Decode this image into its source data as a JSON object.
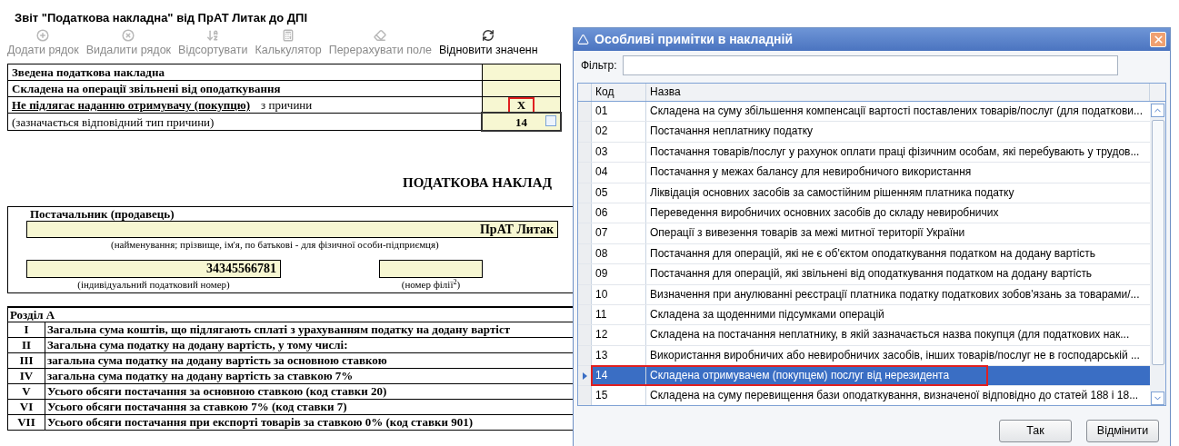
{
  "report": {
    "title": "Звіт \"Податкова накладна\" від ПрАТ Литак до ДПІ",
    "toolbar": [
      {
        "label": "Додати рядок",
        "disabled": true
      },
      {
        "label": "Видалити рядок",
        "disabled": true
      },
      {
        "label": "Відсортувати",
        "disabled": true
      },
      {
        "label": "Калькулятор",
        "disabled": true
      },
      {
        "label": "Перерахувати поле",
        "disabled": true
      },
      {
        "label": "Відновити значенн",
        "disabled": false
      }
    ],
    "flags": [
      {
        "kind": "flag",
        "label": "Зведена податкова накладна"
      },
      {
        "kind": "flag",
        "label": "Складена на операції звільнені від оподаткування"
      },
      {
        "kind": "reason",
        "label": "Не підлягає наданню отримувачу (покупцю)",
        "suffix": "з причини",
        "value": "X"
      },
      {
        "kind": "code",
        "label": "(зазначається відповідний тип причини)",
        "value": "14"
      }
    ],
    "heading": "ПОДАТКОВА НАКЛАД",
    "supplier": {
      "title": "Постачальник (продавець)",
      "name": "ПрАТ Литак",
      "name_caption": "(найменування; прізвище, ім'я, по батькові - для фізичної особи-підприємця)",
      "tax_number": "34345566781",
      "tax_number_caption": "(індивідуальний податковий номер)",
      "branch_caption": "(номер філії$^{2}$)"
    },
    "section": {
      "title": "Розділ А",
      "rows": [
        {
          "num": "I",
          "text": "Загальна сума коштів, що підлягають сплаті з урахуванням податку на додану вартіст"
        },
        {
          "num": "II",
          "text": "Загальна сума податку на додану вартість, у тому числі:"
        },
        {
          "num": "III",
          "text": "загальна сума податку на додану вартість за основною ставкою"
        },
        {
          "num": "IV",
          "text": "загальна сума податку на додану вартість за  ставкою 7%"
        },
        {
          "num": "V",
          "text": "Усього обсяги постачання за основною ставкою (код ставки 20)"
        },
        {
          "num": "VI",
          "text": "Усього обсяги постачання за ставкою 7% (код ставки 7)"
        },
        {
          "num": "VII",
          "text": "Усього обсяги постачання при експорті товарів за ставкою 0% (код ставки 901)"
        }
      ]
    }
  },
  "dialog": {
    "title": "Особливі примітки в накладній",
    "filter_label": "Фільтр:",
    "columns": [
      "Код",
      "Назва"
    ],
    "rows": [
      {
        "code": "01",
        "name": "Складена на суму збільшення компенсації вартості поставлених товарів/послуг (для податкови...",
        "selected": false
      },
      {
        "code": "02",
        "name": "Постачання неплатнику податку",
        "selected": false
      },
      {
        "code": "03",
        "name": "Постачання товарів/послуг у рахунок оплати праці фізичним особам, які перебувають у трудов...",
        "selected": false
      },
      {
        "code": "04",
        "name": "Постачання у межах балансу для невиробничого використання",
        "selected": false
      },
      {
        "code": "05",
        "name": "Ліквідація основних засобів за самостійним рішенням платника податку",
        "selected": false
      },
      {
        "code": "06",
        "name": "Переведення виробничих основних засобів до складу невиробничих",
        "selected": false
      },
      {
        "code": "07",
        "name": "Операції з вивезення товарів за межі митної території України",
        "selected": false
      },
      {
        "code": "08",
        "name": "Постачання для операцій, які не є об'єктом оподаткування податком на додану вартість",
        "selected": false
      },
      {
        "code": "09",
        "name": "Постачання для операцій, які звільнені від оподаткування податком на додану вартість",
        "selected": false
      },
      {
        "code": "10",
        "name": "Визначення при анулюванні реєстрації платника податку податкових зобов'язань за товарами/...",
        "selected": false
      },
      {
        "code": "11",
        "name": "Складена за щоденними підсумками операцій",
        "selected": false
      },
      {
        "code": "12",
        "name": "Складена на постачання неплатнику, в якій зазначається назва покупця (для податкових нак...",
        "selected": false
      },
      {
        "code": "13",
        "name": "Використання виробничих або невиробничих засобів, інших товарів/послуг не в господарській ...",
        "selected": false
      },
      {
        "code": "14",
        "name": "Складена отримувачем (покупцем) послуг від нерезидента",
        "selected": true
      },
      {
        "code": "15",
        "name": "Складена на суму перевищення бази оподаткування, визначеної відповідно до статей 188 і 18...",
        "selected": false
      }
    ],
    "buttons": [
      "Так",
      "Відмінити"
    ]
  }
}
